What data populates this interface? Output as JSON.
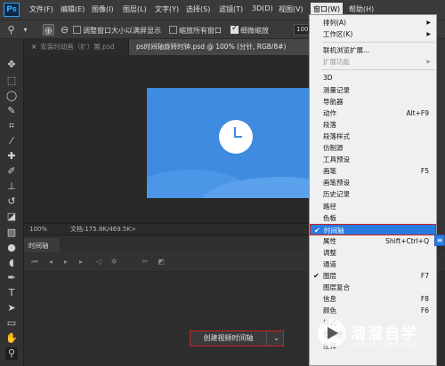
{
  "app": {
    "logo": "Ps"
  },
  "menubar": {
    "items": [
      "文件(F)",
      "编辑(E)",
      "图像(I)",
      "图层(L)",
      "文字(Y)",
      "选择(S)",
      "滤镜(T)",
      "3D(D)",
      "视图(V)",
      "窗口(W)",
      "帮助(H)"
    ]
  },
  "options": {
    "resize_windows": "调整窗口大小以满屏显示",
    "zoom_all": "缩放所有窗口",
    "scrubby_zoom": "细微缩放",
    "zoom_value": "100"
  },
  "tabs": {
    "inactive": "安装时动画（扩）展.psd",
    "active": "ps时间轴旋转时钟.psd @ 100% (分针, RGB/8#)"
  },
  "status": {
    "zoom": "100%",
    "doc_info": "文档:175.8K/469.5K"
  },
  "timeline": {
    "panel_tab": "时间轴",
    "create_button": "创建视频时间轴",
    "dropdown_arrow": "⌄"
  },
  "window_menu": {
    "items": [
      {
        "label": "排列(A)",
        "submenu": true
      },
      {
        "label": "工作区(K)",
        "submenu": true
      },
      {
        "sep": true
      },
      {
        "label": "联机浏览扩展..."
      },
      {
        "label": "扩展功能",
        "submenu": true,
        "disabled": true
      },
      {
        "sep": true
      },
      {
        "label": "3D"
      },
      {
        "label": "测量记录"
      },
      {
        "label": "导航器"
      },
      {
        "label": "动作",
        "shortcut": "Alt+F9"
      },
      {
        "label": "段落"
      },
      {
        "label": "段落样式"
      },
      {
        "label": "仿制源"
      },
      {
        "label": "工具预设"
      },
      {
        "label": "画笔",
        "shortcut": "F5"
      },
      {
        "label": "画笔预设"
      },
      {
        "label": "历史记录"
      },
      {
        "label": "路径"
      },
      {
        "label": "色板"
      },
      {
        "label": "时间轴",
        "checked": true,
        "highlight": true
      },
      {
        "label": "属性",
        "shortcut": "Shift+Ctrl+Q"
      },
      {
        "label": "调整"
      },
      {
        "label": "通道"
      },
      {
        "label": "图层",
        "shortcut": "F7",
        "checked": true
      },
      {
        "label": "图层复合"
      },
      {
        "label": "信息",
        "shortcut": "F8"
      },
      {
        "label": "颜色",
        "shortcut": "F6"
      },
      {
        "label": "样式"
      },
      {
        "label": "直方图"
      },
      {
        "label": "注释"
      }
    ]
  },
  "watermark": {
    "name": "溜溜自学",
    "url": "ZIXUE.3066.COM"
  },
  "colors": {
    "artboard": "#3e8be0",
    "highlight": "#2a7be0",
    "callout": "#d02020"
  }
}
